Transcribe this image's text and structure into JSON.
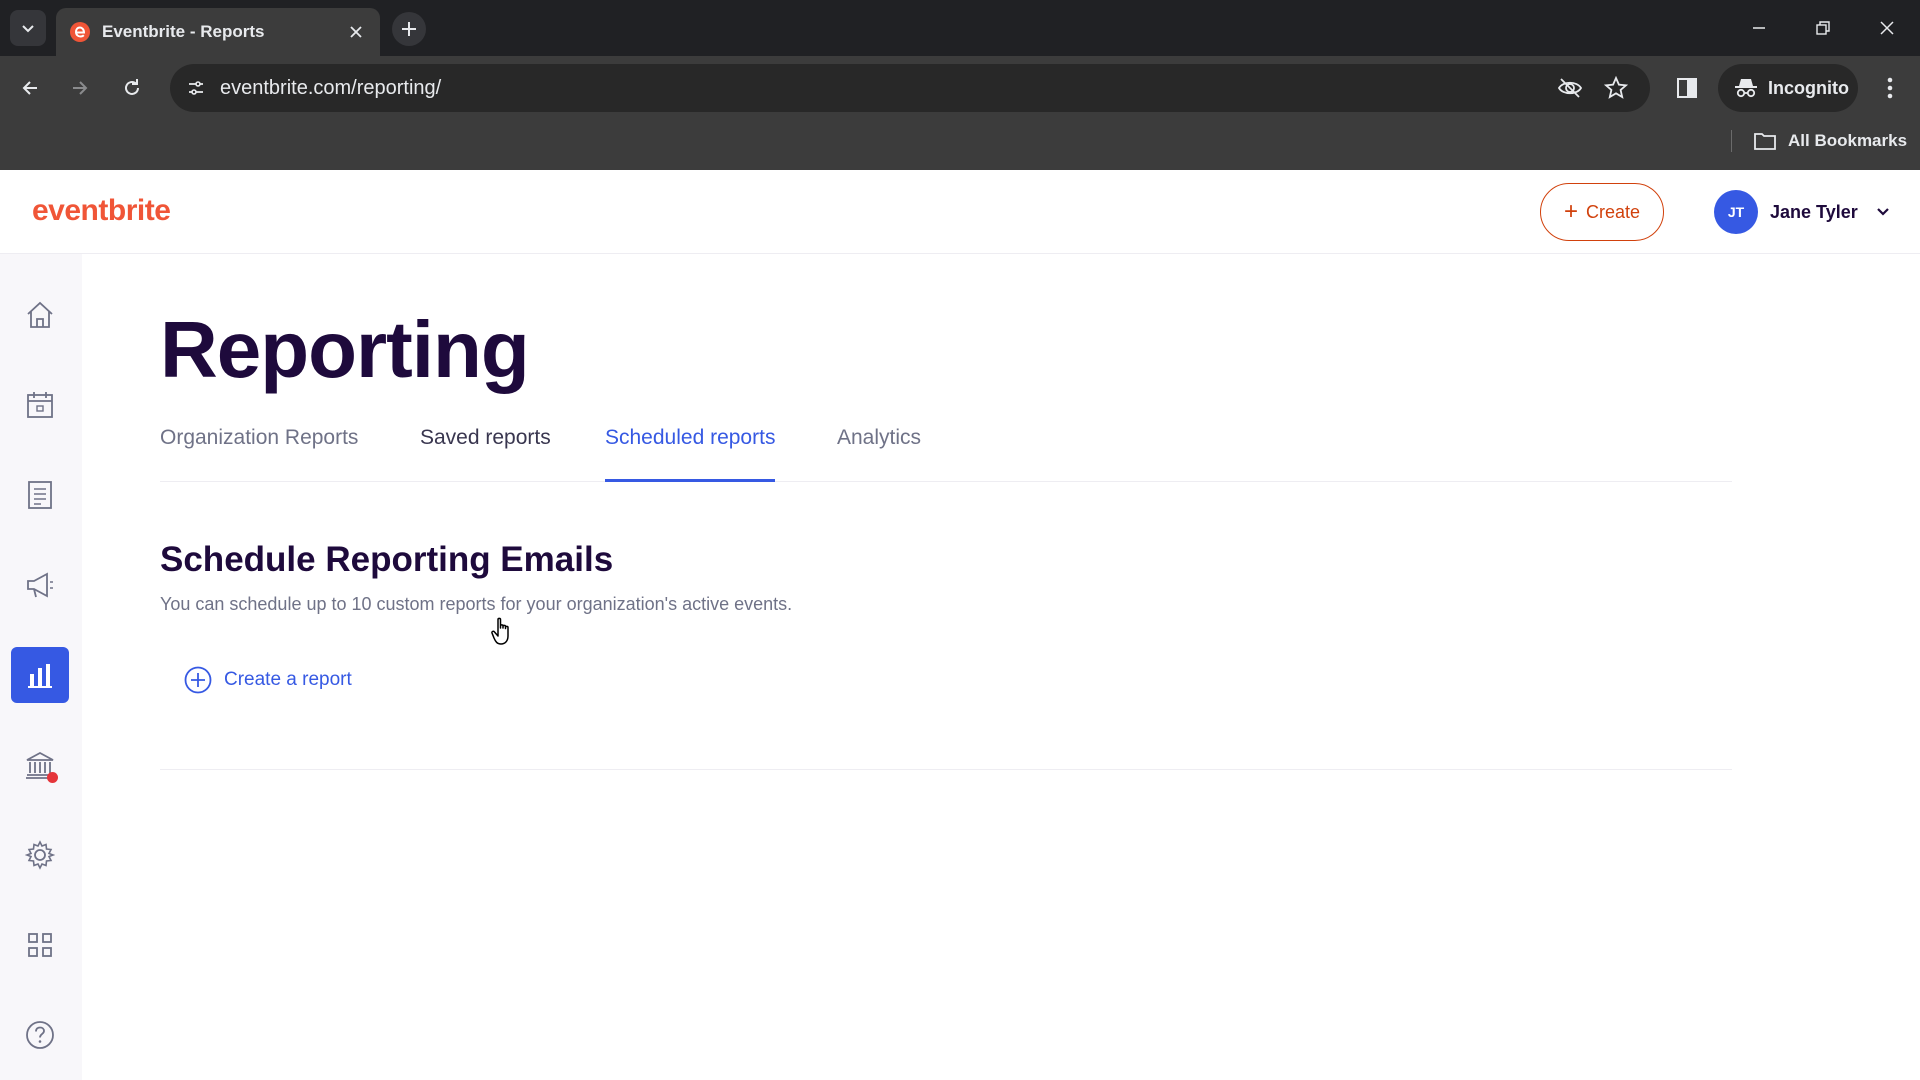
{
  "browser": {
    "tab_title": "Eventbrite - Reports",
    "url": "eventbrite.com/reporting/",
    "incognito_label": "Incognito",
    "bookmarks_label": "All Bookmarks",
    "icons": [
      "tab-search-icon",
      "eventbrite-favicon",
      "close-icon",
      "plus-icon",
      "minimize-icon",
      "restore-icon",
      "close-window-icon",
      "back-icon",
      "forward-icon",
      "reload-icon",
      "site-info-icon",
      "eye-off-icon",
      "star-icon",
      "side-panel-icon",
      "incognito-icon",
      "kebab-menu-icon",
      "folder-icon"
    ]
  },
  "header": {
    "logo": "eventbrite",
    "create_label": "Create",
    "user": {
      "initials": "JT",
      "name": "Jane Tyler"
    }
  },
  "sidebar": {
    "items": [
      {
        "name": "home",
        "icon": "home-icon"
      },
      {
        "name": "events",
        "icon": "calendar-icon"
      },
      {
        "name": "orders",
        "icon": "document-icon"
      },
      {
        "name": "marketing",
        "icon": "megaphone-icon"
      },
      {
        "name": "reporting",
        "icon": "bar-chart-icon",
        "active": true
      },
      {
        "name": "finance",
        "icon": "bank-icon",
        "notification": true
      },
      {
        "name": "settings",
        "icon": "gear-icon"
      },
      {
        "name": "apps",
        "icon": "grid-icon"
      },
      {
        "name": "help",
        "icon": "help-icon"
      }
    ]
  },
  "main": {
    "title": "Reporting",
    "tabs": [
      {
        "label": "Organization Reports"
      },
      {
        "label": "Saved reports"
      },
      {
        "label": "Scheduled reports",
        "active": true
      },
      {
        "label": "Analytics"
      }
    ],
    "section_title": "Schedule Reporting Emails",
    "section_description": "You can schedule up to 10 custom reports for your organization's active events.",
    "create_report_label": "Create a report"
  },
  "colors": {
    "brand_orange": "#f05537",
    "accent_blue": "#3659e3",
    "heading_dark": "#1e0a3c",
    "muted_text": "#6f7287"
  }
}
